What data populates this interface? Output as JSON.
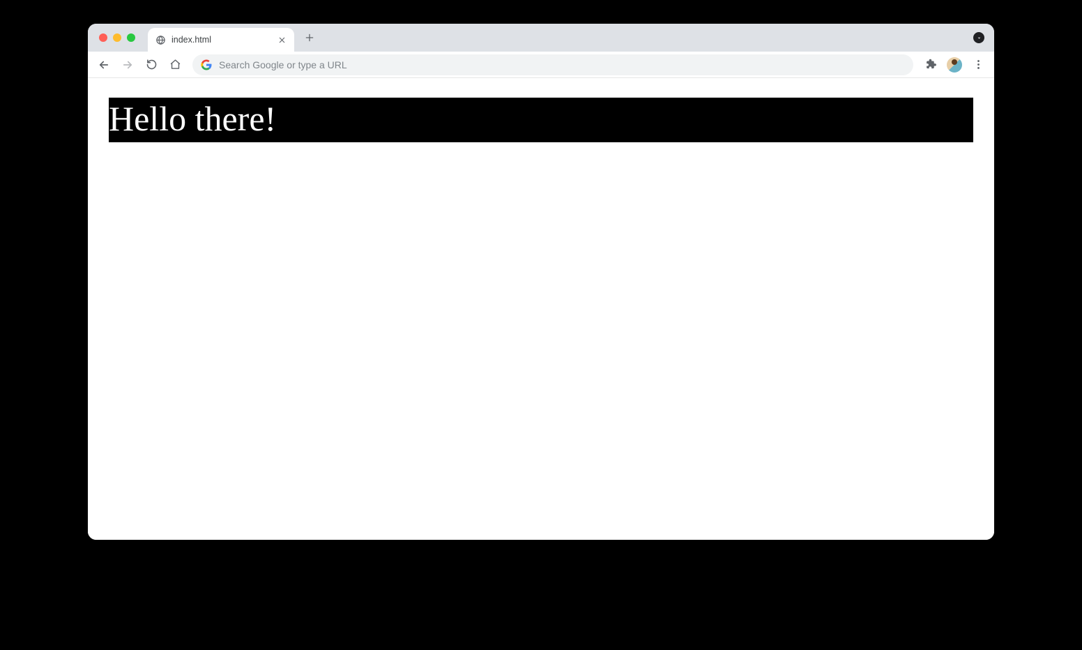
{
  "window": {
    "traffic_lights": {
      "red": "#ff5f57",
      "yellow": "#febc2e",
      "green": "#28c840"
    }
  },
  "tabs": {
    "active": {
      "title": "index.html"
    }
  },
  "toolbar": {
    "omnibox_placeholder": "Search Google or type a URL"
  },
  "page": {
    "heading": "Hello there!"
  }
}
